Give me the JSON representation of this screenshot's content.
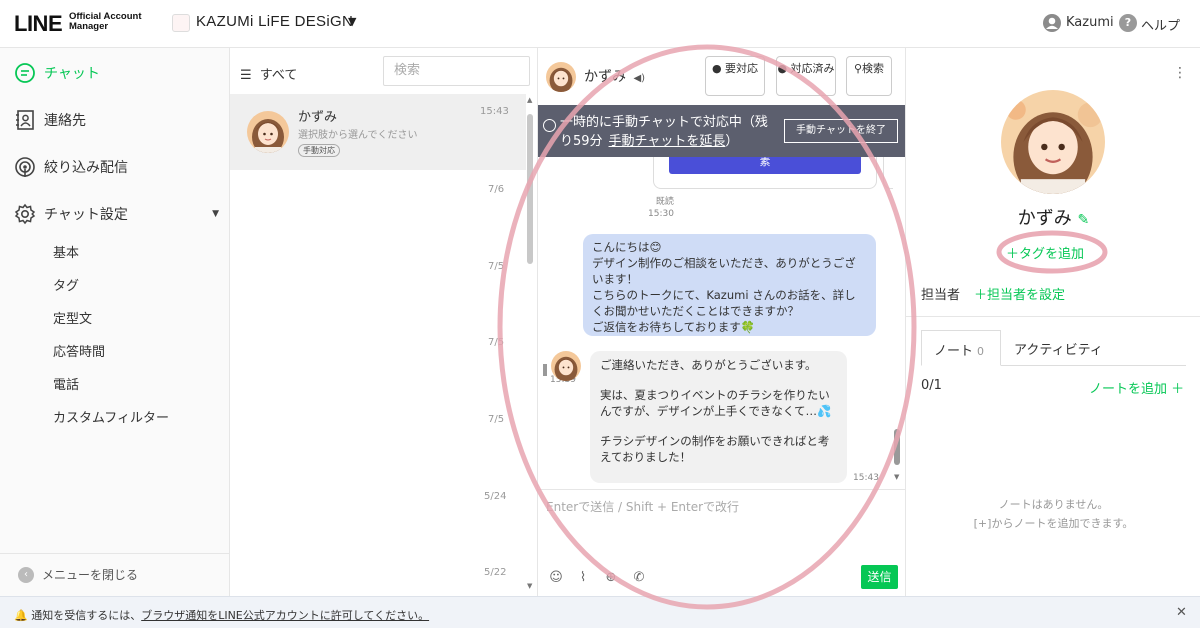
{
  "header": {
    "logo_main": "LINE",
    "logo_sub": "Official Account Manager",
    "account_name": "KAZUMi LiFE DESiGN",
    "user_name": "Kazumi",
    "help_label": "ヘルプ"
  },
  "sidebar": {
    "items": [
      {
        "label": "チャット",
        "icon": "chat-icon",
        "active": true
      },
      {
        "label": "連絡先",
        "icon": "contacts-icon"
      },
      {
        "label": "絞り込み配信",
        "icon": "broadcast-icon"
      },
      {
        "label": "チャット設定",
        "icon": "gear-icon"
      }
    ],
    "sub_items": [
      "基本",
      "タグ",
      "定型文",
      "応答時間",
      "電話",
      "カスタムフィルター"
    ],
    "close_menu": "メニューを閉じる"
  },
  "chat_list": {
    "filter_label": "すべて",
    "search_placeholder": "検索",
    "items": [
      {
        "name": "かずみ",
        "preview": "選択肢から選んでください",
        "badge": "手動対応",
        "time": "15:43"
      }
    ],
    "dates": [
      "7/6",
      "7/5",
      "7/5",
      "7/5",
      "5/24",
      "5/22"
    ]
  },
  "chat": {
    "contact_name": "かずみ",
    "buttons": {
      "follow_up": "要対応",
      "resolved": "対応済み",
      "search": "検索"
    },
    "banner_text_1": "一時的に手動チャットで対応中（残り59分",
    "banner_link": "手動チャットを延長",
    "banner_text_2": "）",
    "banner_end": "手動チャットを終了",
    "card_button_fragment": "素",
    "read_1": "既読",
    "time_1": "15:30",
    "read_2": "既読",
    "time_2": "15:39",
    "outgoing": [
      "こんにちは😊",
      "デザイン制作のご相談をいただき、ありがとうございます！",
      "こちらのトークにて、Kazumi さんのお話を、詳しくお聞かせいただくことはできますか？",
      "ご返信をお待ちしております🍀"
    ],
    "incoming": [
      "ご連絡いただき、ありがとうございます。",
      "実は、夏まつりイベントのチラシを作りたいんですが、デザインが上手くできなくて…💦",
      "チラシデザインの制作をお願いできればと考えておりました！"
    ],
    "incoming_time": "15:43",
    "input_placeholder": "Enterで送信 / Shift + Enterで改行",
    "send_label": "送信"
  },
  "profile": {
    "name": "かずみ",
    "add_tag": "＋タグを追加",
    "assignee_label": "担当者",
    "assignee_set": "＋担当者を設定",
    "tab_note": "ノート",
    "tab_note_count": "0",
    "tab_activity": "アクティビティ",
    "note_count": "0/1",
    "note_add": "ノートを追加 ＋",
    "empty_line_1": "ノートはありません。",
    "empty_line_2": "[+]からノートを追加できます。"
  },
  "notification": {
    "text_1": "通知を受信するには、",
    "link": "ブラウザ通知をLINE公式アカウントに許可してください。"
  },
  "colors": {
    "accent": "#06c755",
    "banner": "#5c5f6e",
    "bubble_out": "#cfdcf6",
    "highlight": "#e8a4b0"
  }
}
